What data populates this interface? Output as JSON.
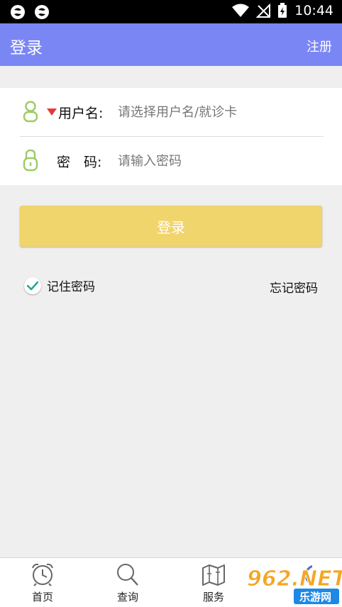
{
  "status_bar": {
    "time": "10:44"
  },
  "header": {
    "title": "登录",
    "register_label": "注册"
  },
  "form": {
    "username_label": "用户名:",
    "username_placeholder": "请选择用户名/就诊卡",
    "password_label": "密　码:",
    "password_placeholder": "请输入密码"
  },
  "login_button_label": "登录",
  "remember_label": "记住密码",
  "forgot_label": "忘记密码",
  "bottom_nav": {
    "items": [
      {
        "label": "首页"
      },
      {
        "label": "查询"
      },
      {
        "label": "服务"
      }
    ]
  },
  "watermark": {
    "brand": "962.NET",
    "sub": "乐游网"
  },
  "colors": {
    "app_bar": "#7b86f5",
    "login_button": "#f0d46c",
    "icon_green": "#9ccc65",
    "dropdown_red": "#e53935"
  }
}
